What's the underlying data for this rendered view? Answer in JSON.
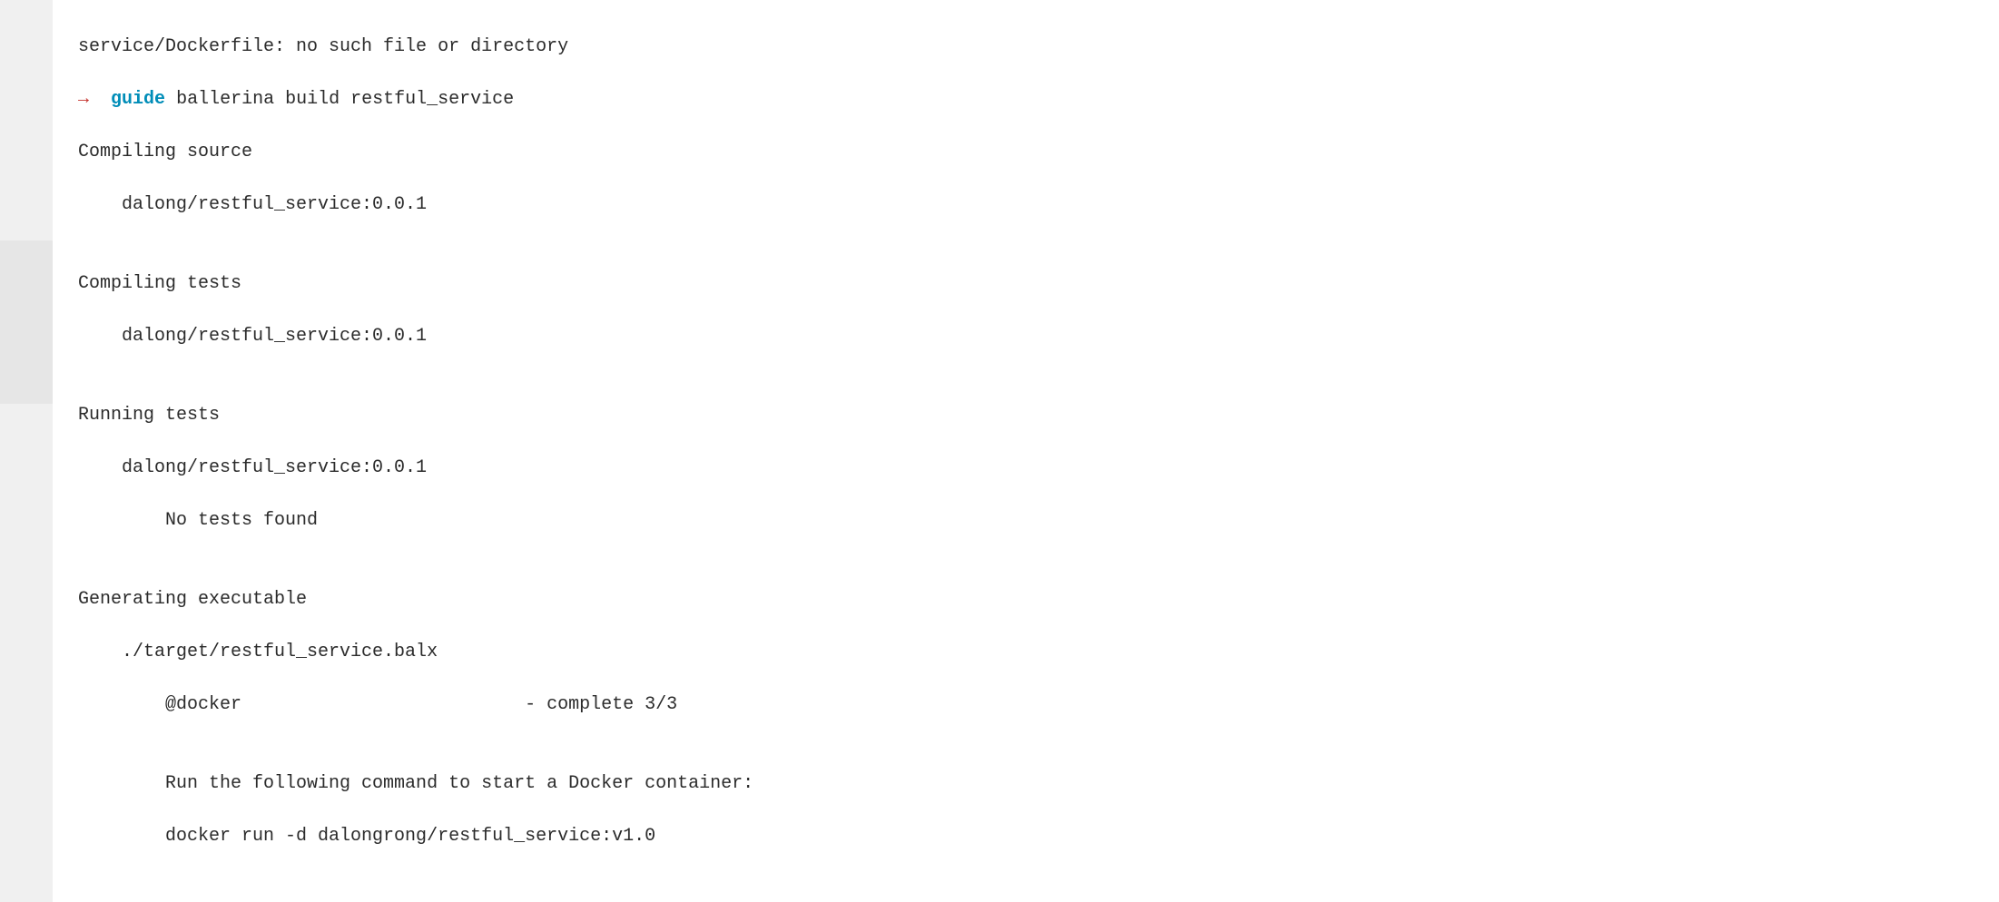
{
  "terminal": {
    "line0": "service/Dockerfile: no such file or directory",
    "prompt": {
      "arrow": "→",
      "path": "guide",
      "command": "ballerina build restful_service"
    },
    "line_compiling_source": "Compiling source",
    "line_compiling_source_pkg": "    dalong/restful_service:0.0.1",
    "blank1": "",
    "line_compiling_tests": "Compiling tests",
    "line_compiling_tests_pkg": "    dalong/restful_service:0.0.1",
    "blank2": "",
    "line_running_tests": "Running tests",
    "line_running_tests_pkg": "    dalong/restful_service:0.0.1",
    "line_no_tests": "        No tests found",
    "blank3": "",
    "line_generating": "Generating executable",
    "line_target": "    ./target/restful_service.balx",
    "line_docker": "        @docker \t\t\t - complete 3/3",
    "blank4": "",
    "line_run_hint": "        Run the following command to start a Docker container:",
    "line_docker_run": "        docker run -d dalongrong/restful_service:v1.0",
    "blank5": ""
  }
}
